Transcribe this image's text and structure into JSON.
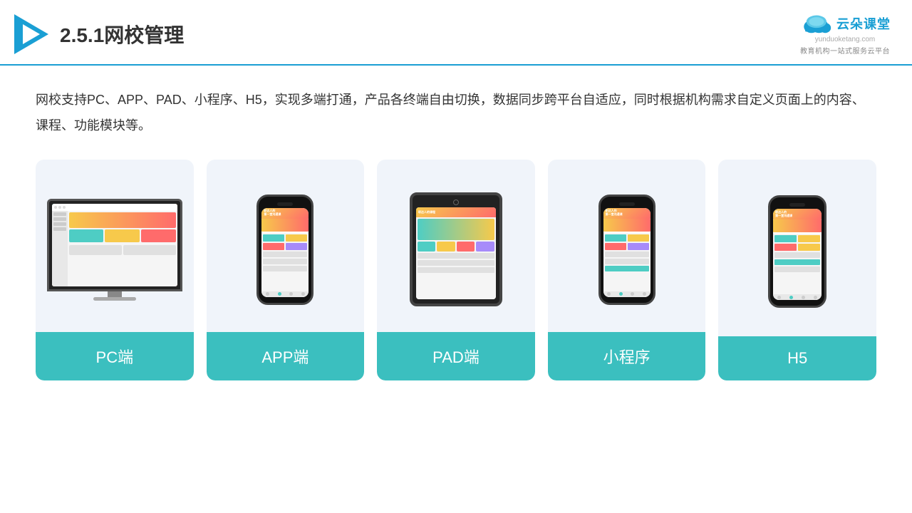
{
  "header": {
    "title": "2.5.1网校管理",
    "logo_name": "云朵课堂",
    "logo_domain": "yunduoketang.com",
    "logo_subtitle": "教育机构一站\n式服务云平台"
  },
  "description": {
    "text": "网校支持PC、APP、PAD、小程序、H5，实现多端打通，产品各终端自由切换，数据同步跨平台自适应，同时根据机构需求自定义页面上的内容、课程、功能模块等。"
  },
  "cards": [
    {
      "id": "pc",
      "label": "PC端"
    },
    {
      "id": "app",
      "label": "APP端"
    },
    {
      "id": "pad",
      "label": "PAD端"
    },
    {
      "id": "miniprogram",
      "label": "小程序"
    },
    {
      "id": "h5",
      "label": "H5"
    }
  ],
  "accent_color": "#3bbfbf",
  "card_bg": "#eef2f8"
}
